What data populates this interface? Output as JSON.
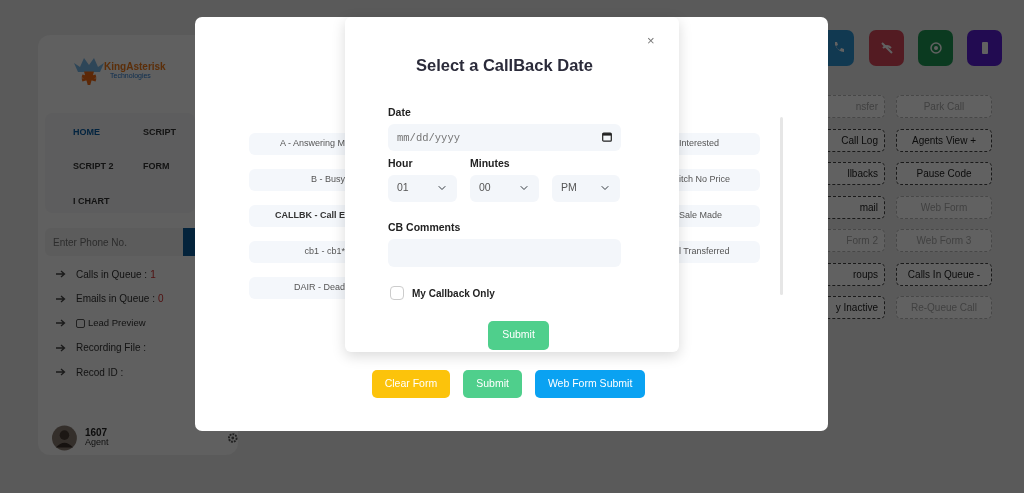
{
  "sidebar": {
    "logo": {
      "name": "KingAsterisk",
      "tagline": "Technologies"
    },
    "nav": [
      {
        "label": "HOME",
        "selected": true
      },
      {
        "label": "SCRIPT",
        "selected": false
      },
      {
        "label": "SCRIPT 2",
        "selected": false
      },
      {
        "label": "FORM",
        "selected": false
      },
      {
        "label": "I CHART",
        "selected": false
      }
    ],
    "phone": {
      "placeholder": "Enter Phone No."
    },
    "info": [
      {
        "kind": "stat",
        "label": "Calls in Queue :",
        "value": "1"
      },
      {
        "kind": "stat",
        "label": "Emails in Queue :",
        "value": "0"
      },
      {
        "kind": "checkbox",
        "label": "Lead Preview",
        "checked": false
      },
      {
        "kind": "text",
        "label": "Recording File :"
      },
      {
        "kind": "text",
        "label": "Recod ID :"
      }
    ],
    "agent": {
      "id": "1607",
      "role": "Agent"
    }
  },
  "controls": {
    "icon_buttons": [
      {
        "kind": "phone"
      },
      {
        "kind": "hangup"
      },
      {
        "kind": "record"
      },
      {
        "kind": "mobile"
      }
    ],
    "buttons": [
      {
        "label": "nsfer",
        "disabled": true
      },
      {
        "label": "Park Call",
        "disabled": true
      },
      {
        "label": "Call Log",
        "disabled": false
      },
      {
        "label": "Agents View +",
        "disabled": false
      },
      {
        "label": "llbacks",
        "disabled": false
      },
      {
        "label": "Pause Code",
        "disabled": false
      },
      {
        "label": "mail",
        "disabled": false
      },
      {
        "label": "Web Form",
        "disabled": true
      },
      {
        "label": "Form 2",
        "disabled": true
      },
      {
        "label": "Web Form 3",
        "disabled": true
      },
      {
        "label": "roups",
        "disabled": false
      },
      {
        "label": "Calls In Queue -",
        "disabled": false
      },
      {
        "label": "y Inactive",
        "disabled": false
      },
      {
        "label": "Re-Queue Call",
        "disabled": true
      }
    ]
  },
  "disposition_dialog": {
    "left": [
      {
        "label": "A - Answering M",
        "selected": false
      },
      {
        "label": "B - Busy",
        "selected": false
      },
      {
        "label": "CALLBK - Call E",
        "selected": true
      },
      {
        "label": "cb1 - cb1*",
        "selected": false
      },
      {
        "label": "DAIR - Dead",
        "selected": false
      }
    ],
    "right": [
      {
        "label": "Interested",
        "selected": false
      },
      {
        "label": "itch No Price",
        "selected": false
      },
      {
        "label": "Sale Made",
        "selected": false
      },
      {
        "label": "l Transferred",
        "selected": false
      }
    ],
    "buttons": [
      {
        "label": "Clear Form",
        "kind": "warning"
      },
      {
        "label": "Submit",
        "kind": "success"
      },
      {
        "label": "Web Form Submit",
        "kind": "primary"
      }
    ]
  },
  "callback_dialog": {
    "title": "Select a CallBack Date",
    "close": "×",
    "date": {
      "label": "Date",
      "placeholder": "mm/dd/yyyy"
    },
    "hour": {
      "label": "Hour",
      "value": "01"
    },
    "minutes": {
      "label": "Minutes",
      "value": "00"
    },
    "ampm": {
      "value": "PM"
    },
    "comments": {
      "label": "CB Comments"
    },
    "my_callback_only": {
      "label": "My Callback Only",
      "checked": false
    },
    "submit": "Submit"
  }
}
